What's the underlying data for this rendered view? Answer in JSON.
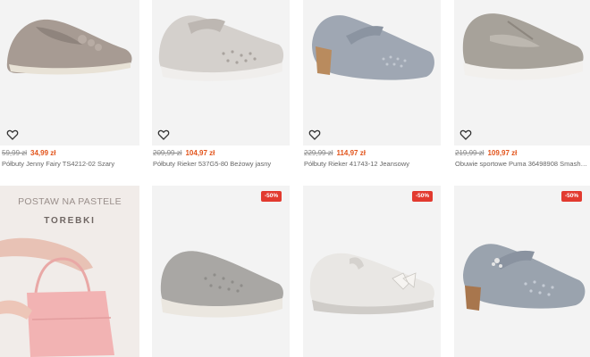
{
  "products": [
    {
      "old_price": "59,99 zł",
      "new_price": "34,99 zł",
      "name": "Półbuty Jenny Fairy TS4212-02 Szary",
      "wishlist_icon": "heart-outline-icon"
    },
    {
      "old_price": "209,99 zł",
      "new_price": "104,97 zł",
      "name": "Półbuty Rieker 537G5-80 Beżowy jasny",
      "wishlist_icon": "heart-outline-icon"
    },
    {
      "old_price": "229,99 zł",
      "new_price": "114,97 zł",
      "name": "Półbuty Rieker 41743-12 Jeansowy",
      "wishlist_icon": "heart-outline-icon"
    },
    {
      "old_price": "219,99 zł",
      "new_price": "109,97 zł",
      "name": "Obuwie sportowe Puma 36498908 Smash v...",
      "wishlist_icon": "heart-outline-icon"
    }
  ],
  "promo": {
    "line1": "POSTAW NA PASTELE",
    "line2": "TOREBKI"
  },
  "bottom_products": [
    {
      "badge": "-50%"
    },
    {
      "badge": "-50%"
    },
    {
      "badge": "-50%"
    }
  ],
  "colors": {
    "sale_price": "#e2541b",
    "badge": "#e23a2f",
    "tile_bg": "#f3f3f3"
  }
}
